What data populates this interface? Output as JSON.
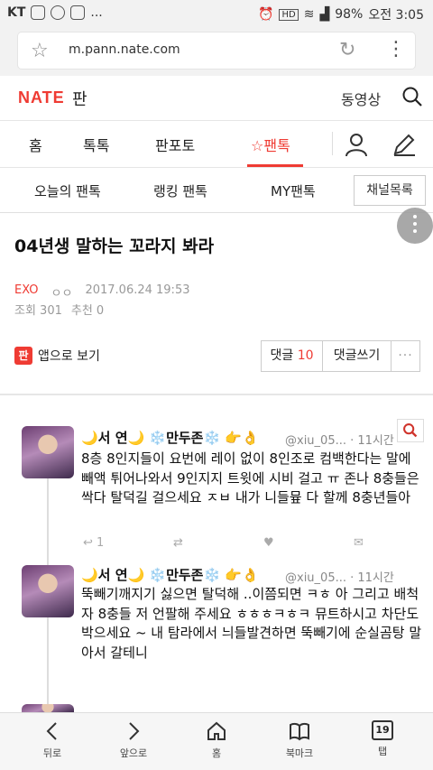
{
  "status_bar": {
    "carrier": "KT",
    "extra": "...",
    "battery": "98%",
    "time": "오전 3:05",
    "hd": "HD"
  },
  "browser": {
    "url": "m.pann.nate.com"
  },
  "header": {
    "logo": "NATE",
    "logo_sub": "판",
    "video_link": "동영상"
  },
  "nav": {
    "tabs": [
      "홈",
      "톡톡",
      "판포토",
      "☆팬톡"
    ],
    "active": "☆팬톡"
  },
  "subnav": {
    "tabs": [
      "오늘의 팬톡",
      "랭킹 팬톡",
      "MY팬톡"
    ],
    "channel_button": "채널목록"
  },
  "article": {
    "title": "04년생 말하는 꼬라지 봐라",
    "category": "EXO",
    "author": "ㅇㅇ",
    "date": "2017.06.24 19:53",
    "views": "조회 301",
    "recommend": "추천 0",
    "app_label": "앱으로 보기",
    "app_icon": "판",
    "comments_label": "댓글",
    "comments_count": "10",
    "write_label": "댓글쓰기",
    "more_label": "···"
  },
  "tweets": [
    {
      "name": "🌙서 연🌙 ❄️만두존❄️ 👉👌",
      "handle": "@xiu_05... · 11시간",
      "text": "8층 8인지들이 요번에 레이 없이 8인조로 컴백한다는 말에 빼액 튀어나와서 9인지지 트윗에 시비 걸고 ㅠ 존나 8충들은 싹다 탈덕길 걸으세요 ㅈㅂ 내가 니들뮾 다 할께 8충년들아",
      "reply_count": "1",
      "retweet_count": "",
      "like_count": ""
    },
    {
      "name": "🌙서 연🌙 ❄️만두존❄️ 👉👌",
      "handle": "@xiu_05... · 11시간",
      "text": "뚝빼기깨지기 싫으면 탈덕해 ..이쯤되면 ㅋㅎ 아 그리고 배척자 8충들 저 언팔해 주세요 ㅎㅎㅎㅋㅎㅋ 뮤트하시고 차단도 박으세요 ~ 내 탐라에서 늬들발견하면 뚝빼기에 순실곰탕 말아서 갈테니"
    }
  ],
  "bottom_nav": {
    "back": "뒤로",
    "forward": "앞으로",
    "home": "홈",
    "bookmark": "북마크",
    "tabs": "탭",
    "tab_count": "19"
  },
  "colors": {
    "brand_red": "#ef3b33",
    "muted": "#999999"
  }
}
